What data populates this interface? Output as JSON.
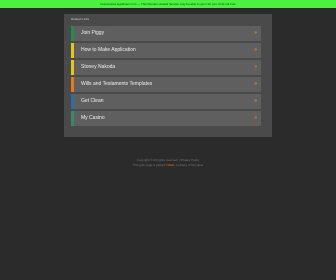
{
  "top_bar": {
    "notice": "bestreviews.legitdirect.com — This Domain Hosted Service may be able to get it for you. Find out how"
  },
  "panel": {
    "title": "Related Links",
    "items": [
      {
        "label": "Join Piggy",
        "arrow": "»",
        "accent": "#1f8f4a"
      },
      {
        "label": "How to Make Application",
        "arrow": "»",
        "accent": "#e3c81a"
      },
      {
        "label": "Stoney Nakoda",
        "arrow": "»",
        "accent": "#e3c81a"
      },
      {
        "label": "Wills and Testaments Templates",
        "arrow": "»",
        "accent": "#e07d1a"
      },
      {
        "label": "Get Clean",
        "arrow": "»",
        "accent": "#2a6f9e"
      },
      {
        "label": "My Casino",
        "arrow": "»",
        "accent": "#3a8a6a"
      }
    ]
  },
  "footer": {
    "line1": "Copyright © All rights reserved. | Privacy Policy",
    "line2_prefix": "This web page is parked ",
    "line2_link": "FREE",
    "line2_suffix": ", courtesy of Domains"
  },
  "colors": {
    "background": "#2b2b2b",
    "top_bar": "#4cf041",
    "panel": "#4a4a4a",
    "item": "#5f5f5f",
    "arrow": "#f08a24"
  }
}
